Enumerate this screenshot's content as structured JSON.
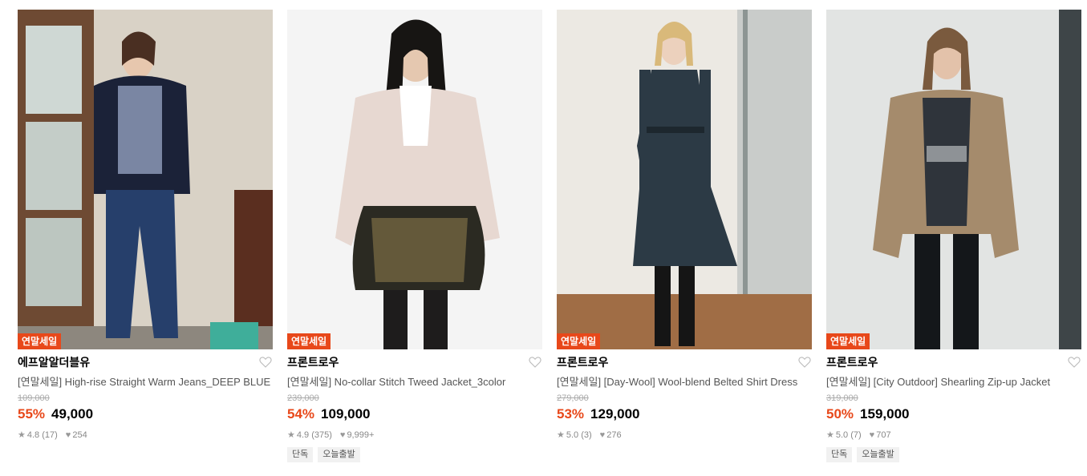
{
  "products": [
    {
      "badge": "연말세일",
      "brand": "에프알알더블유",
      "title": "[연말세일] High-rise Straight Warm Jeans_DEEP BLUE",
      "original_price": "109,000",
      "discount": "55%",
      "price": "49,000",
      "rating": "4.8 (17)",
      "likes": "254",
      "tags": []
    },
    {
      "badge": "연말세일",
      "brand": "프론트로우",
      "title": "[연말세일] No-collar Stitch Tweed Jacket_3color",
      "original_price": "239,000",
      "discount": "54%",
      "price": "109,000",
      "rating": "4.9 (375)",
      "likes": "9,999+",
      "tags": [
        "단독",
        "오늘출발"
      ]
    },
    {
      "badge": "연말세일",
      "brand": "프론트로우",
      "title": "[연말세일] [Day-Wool] Wool-blend Belted Shirt Dress",
      "original_price": "279,000",
      "discount": "53%",
      "price": "129,000",
      "rating": "5.0 (3)",
      "likes": "276",
      "tags": []
    },
    {
      "badge": "연말세일",
      "brand": "프론트로우",
      "title": "[연말세일] [City Outdoor] Shearling Zip-up Jacket",
      "original_price": "319,000",
      "discount": "50%",
      "price": "159,000",
      "rating": "5.0 (7)",
      "likes": "707",
      "tags": [
        "단독",
        "오늘출발"
      ]
    }
  ],
  "icons": {
    "wishlist": "heart-outline-icon",
    "rating": "star-icon",
    "likes": "heart-filled-icon"
  },
  "colors": {
    "accent": "#e8481a",
    "badge_bg": "#e8481a",
    "muted_text": "#888888"
  }
}
